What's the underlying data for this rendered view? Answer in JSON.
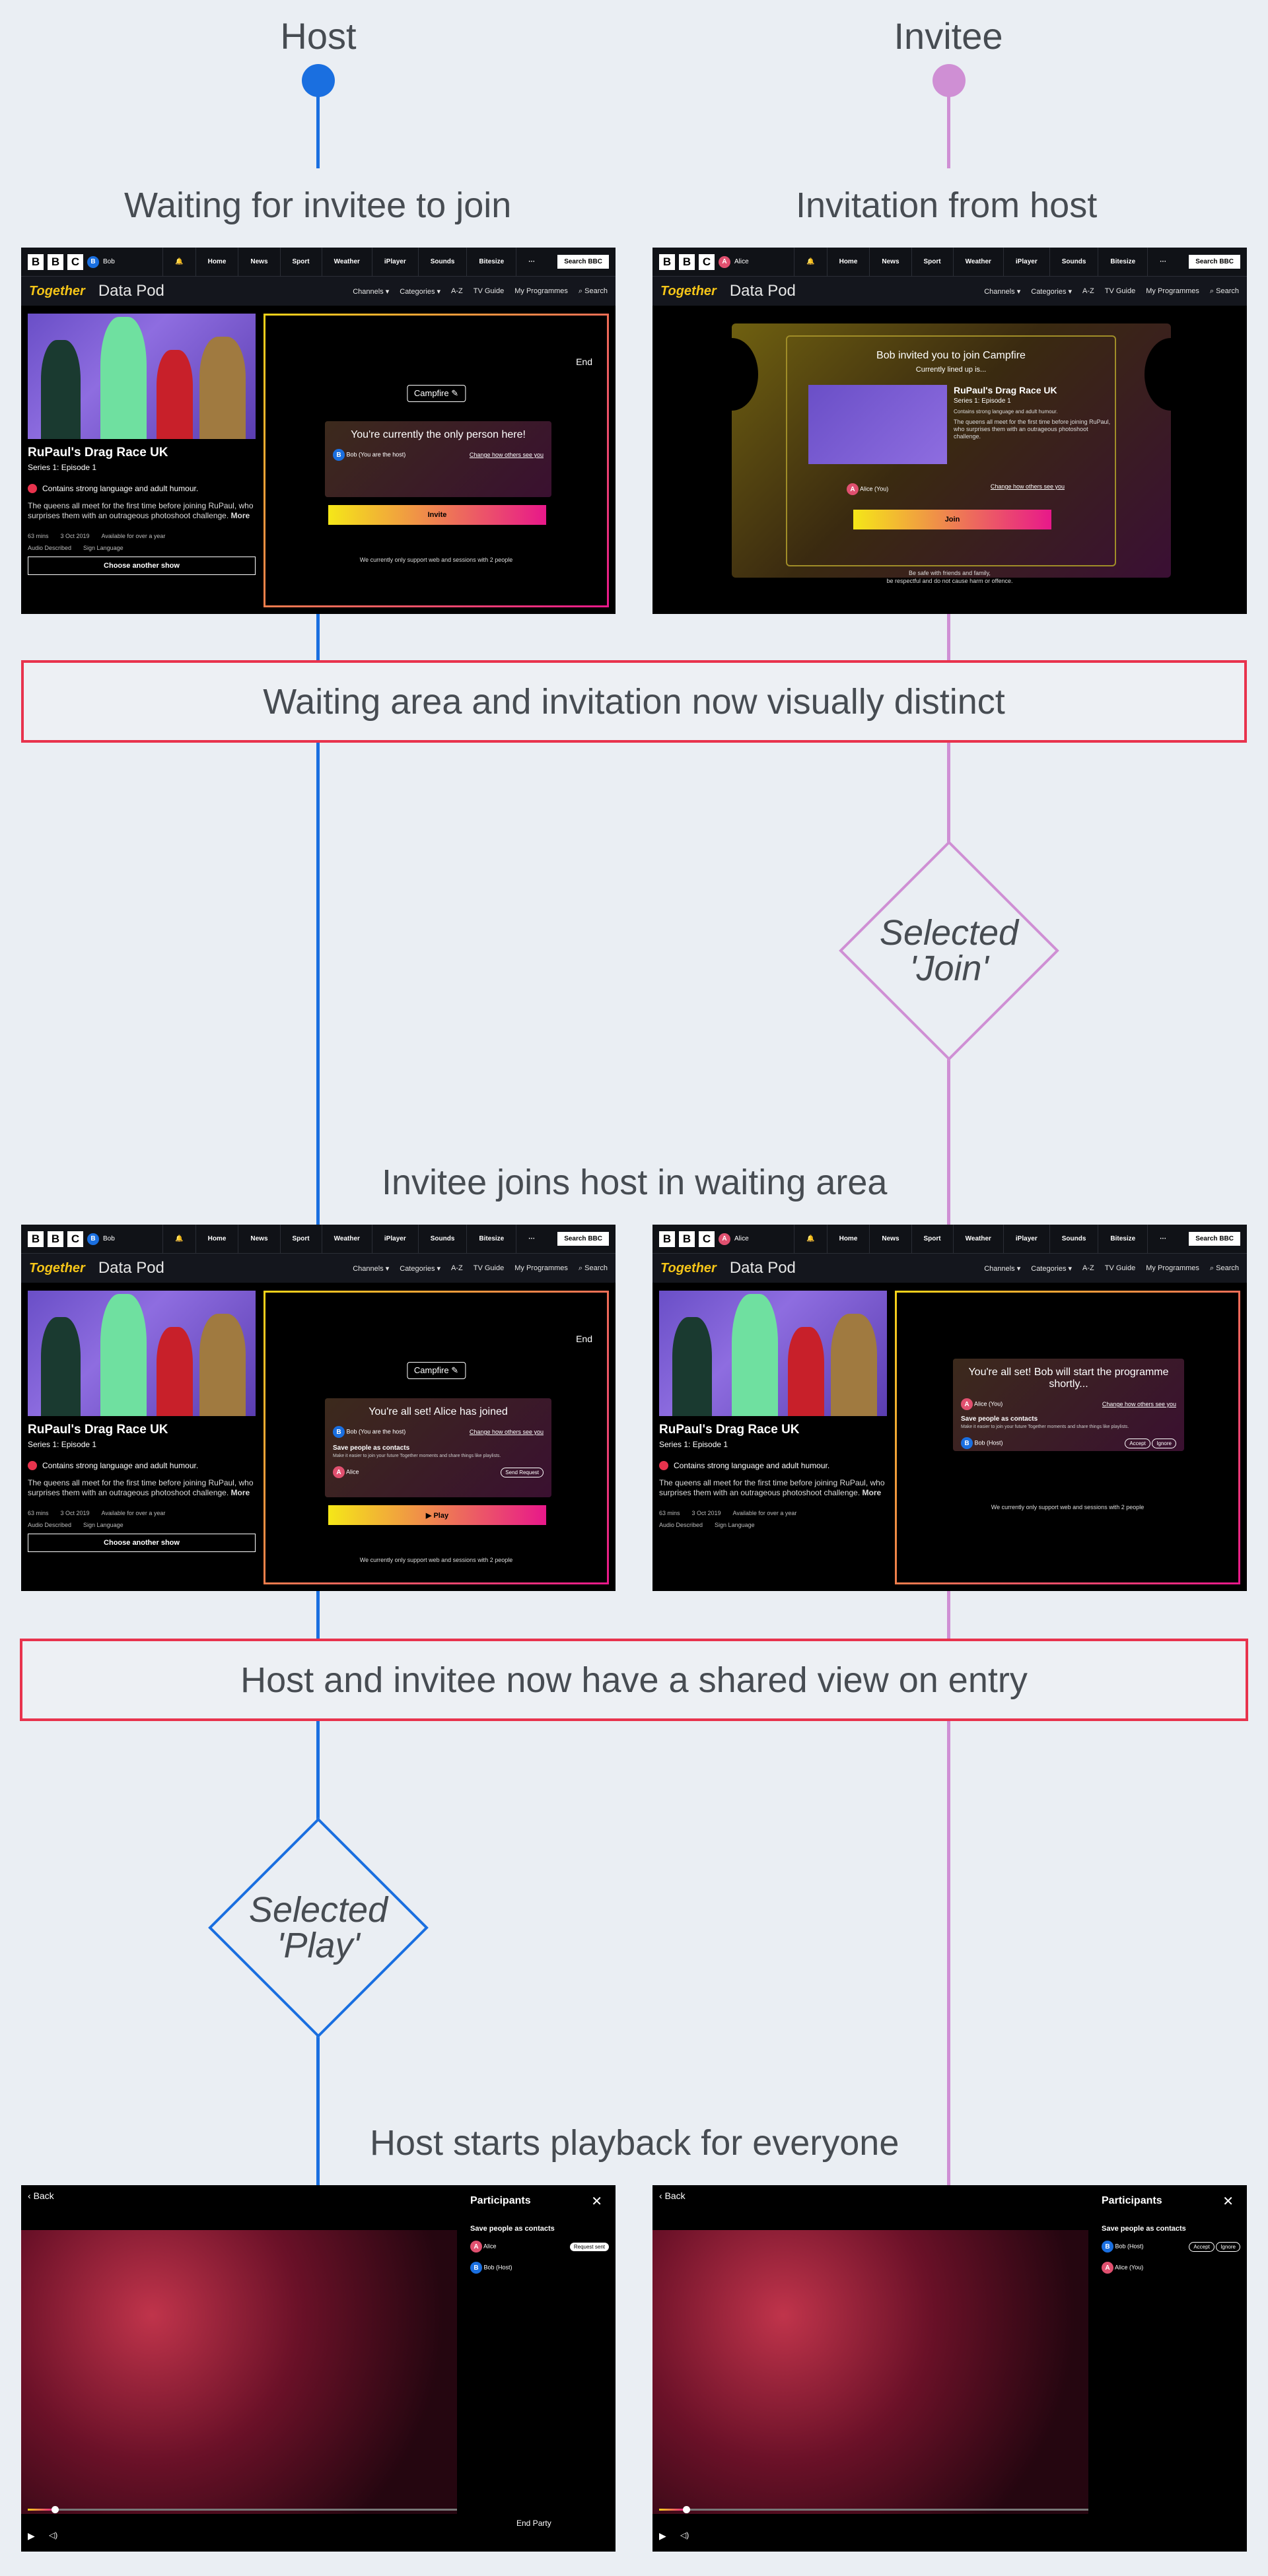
{
  "lanes": {
    "host": "Host",
    "invitee": "Invitee"
  },
  "colors": {
    "host": "#1a6fe0",
    "invitee": "#cf8fd4",
    "note_border": "#e8334d"
  },
  "sections": {
    "s1_host": "Waiting for invitee to join",
    "s1_invitee": "Invitation from host",
    "s2": "Invitee joins host in waiting area",
    "s3": "Host starts playback for everyone"
  },
  "notes": {
    "n1": "Waiting area and invitation now visually distinct",
    "n2": "Host and invitee now have a shared view on entry"
  },
  "decisions": {
    "join_l1": "Selected",
    "join_l2": "'Join'",
    "play_l1": "Selected",
    "play_l2": "'Play'"
  },
  "ui": {
    "bbc": [
      "B",
      "B",
      "C"
    ],
    "bob": "Bob",
    "alice": "Alice",
    "nav": [
      "Home",
      "News",
      "Sport",
      "Weather",
      "iPlayer",
      "Sounds",
      "Bitesize",
      "···"
    ],
    "search_bbc": "Search BBC",
    "together": "Together",
    "data_pod": "Data Pod",
    "subnav": [
      "Channels ▾",
      "Categories ▾",
      "A-Z",
      "TV Guide",
      "My Programmes",
      "⌕ Search"
    ],
    "show_title": "RuPaul's Drag Race UK",
    "show_sub": "Series 1: Episode 1",
    "warning": "Contains strong language and adult humour.",
    "desc": "The queens all meet for the first time before joining RuPaul, who surprises them with an outrageous photoshoot challenge.",
    "more": "More",
    "meta": [
      "63 mins",
      "3 Oct 2019",
      "Available for over a year"
    ],
    "meta2": [
      "Audio Described",
      "Sign Language"
    ],
    "choose": "Choose another show",
    "campfire": "Campfire ✎",
    "end": "End",
    "only_person": "You're currently the only person here!",
    "bob_host": "Bob (You are the host)",
    "change_how": "Change how others see you",
    "invite": "Invite",
    "support_note": "We currently only support web and sessions with 2 people",
    "invited": "Bob invited you to join Campfire",
    "lined_up": "Currently lined up is...",
    "alice_you": "Alice (You)",
    "join": "Join",
    "safe_note1": "Be safe with friends and family,",
    "safe_note2": "be respectful and do not cause harm or offence.",
    "all_set_host": "You're all set! Alice has joined",
    "save_contacts": "Save people as contacts",
    "save_desc": "Make it easier to join your future Together moments and share things like playlists.",
    "send_request": "Send Request",
    "play": "▶ Play",
    "all_set_inv": "You're all set! Bob will start the programme shortly...",
    "bob_host_short": "Bob (Host)",
    "accept": "Accept",
    "ignore": "Ignore",
    "back": "Back",
    "participants": "Participants",
    "request_sent": "Request sent",
    "end_party": "End Party",
    "close": "✕"
  }
}
